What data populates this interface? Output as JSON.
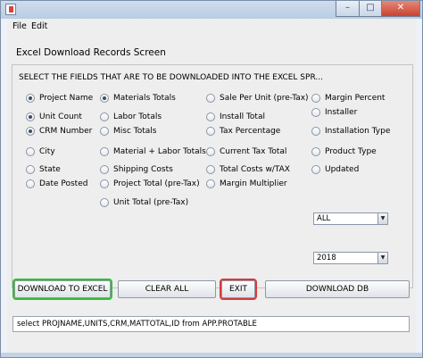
{
  "window": {
    "app_icon": "java-app-icon",
    "controls": {
      "minimize": "–",
      "maximize": "□",
      "close": "✕"
    }
  },
  "menu": {
    "items": [
      "File",
      "Edit"
    ]
  },
  "screen_title": "Excel Download Records Screen",
  "prompt": "SELECT THE FIELDS THAT ARE TO BE DOWNLOADED INTO THE EXCEL SPR...",
  "fields": {
    "col1": [
      {
        "label": "Project Name",
        "selected": true
      },
      {
        "label": "Unit Count",
        "selected": true
      },
      {
        "label": "CRM Number",
        "selected": true
      },
      {
        "label": "City",
        "selected": false
      },
      {
        "label": "State",
        "selected": false
      },
      {
        "label": "Date Posted",
        "selected": false
      }
    ],
    "col2": [
      {
        "label": "Materials Totals",
        "selected": true
      },
      {
        "label": "Labor Totals",
        "selected": false
      },
      {
        "label": "Misc Totals",
        "selected": false
      },
      {
        "label": "Material + Labor Totals",
        "selected": false
      },
      {
        "label": "Shipping Costs",
        "selected": false
      },
      {
        "label": "Project Total (pre-Tax)",
        "selected": false
      },
      {
        "label": "Unit Total (pre-Tax)",
        "selected": false
      }
    ],
    "col3": [
      {
        "label": "Sale Per Unit (pre-Tax)",
        "selected": false
      },
      {
        "label": "Install Total",
        "selected": false
      },
      {
        "label": "Tax Percentage",
        "selected": false
      },
      {
        "label": "Current Tax Total",
        "selected": false
      },
      {
        "label": "Total Costs w/TAX",
        "selected": false
      },
      {
        "label": "Margin Multiplier",
        "selected": false
      }
    ],
    "col4": [
      {
        "label": "Margin Percent",
        "selected": false
      },
      {
        "label": "Installer",
        "selected": false
      },
      {
        "label": "Installation Type",
        "selected": false
      },
      {
        "label": "Product Type",
        "selected": false
      },
      {
        "label": "Updated",
        "selected": false
      }
    ]
  },
  "filters": {
    "month": "ALL",
    "year": "2018"
  },
  "buttons": {
    "download_excel": "DOWNLOAD TO EXCEL",
    "clear_all": "CLEAR ALL",
    "exit": "EXIT",
    "download_db": "DOWNLOAD DB"
  },
  "query": "select PROJNAME,UNITS,CRM,MATTOTAL,ID from APP.PROTABLE",
  "colors": {
    "highlight_green": "#2ec12e",
    "highlight_red": "#d83a3a"
  }
}
